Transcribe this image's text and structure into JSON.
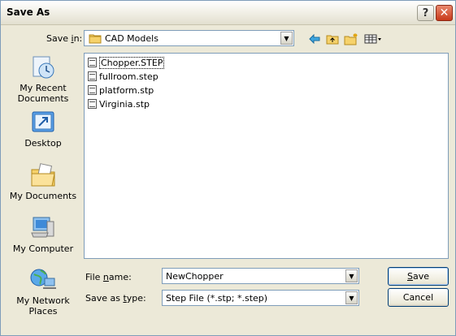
{
  "window": {
    "title": "Save As"
  },
  "titlebar": {
    "help_label": "?",
    "close_label": "✕"
  },
  "save_in": {
    "label_pre": "Save ",
    "label_key": "i",
    "label_post": "n:",
    "value": "CAD Models"
  },
  "places": [
    {
      "line1": "My Recent",
      "line2": "Documents"
    },
    {
      "line1": "Desktop",
      "line2": ""
    },
    {
      "line1": "My Documents",
      "line2": ""
    },
    {
      "line1": "My Computer",
      "line2": ""
    },
    {
      "line1": "My Network",
      "line2": "Places"
    }
  ],
  "files": [
    {
      "name": "Chopper.STEP"
    },
    {
      "name": "fullroom.step"
    },
    {
      "name": "platform.stp"
    },
    {
      "name": "Virginia.stp"
    }
  ],
  "file_name": {
    "label_pre": "File ",
    "label_key": "n",
    "label_post": "ame:",
    "value": "NewChopper"
  },
  "save_as_type": {
    "label_pre": "Save as ",
    "label_key": "t",
    "label_post": "ype:",
    "value": "Step File (*.stp; *.step)"
  },
  "buttons": {
    "save_key": "S",
    "save_rest": "ave",
    "cancel": "Cancel"
  },
  "colors": {
    "accent_border": "#7f9db9",
    "dialog_bg": "#ece9d8",
    "close_red": "#c8391a"
  }
}
